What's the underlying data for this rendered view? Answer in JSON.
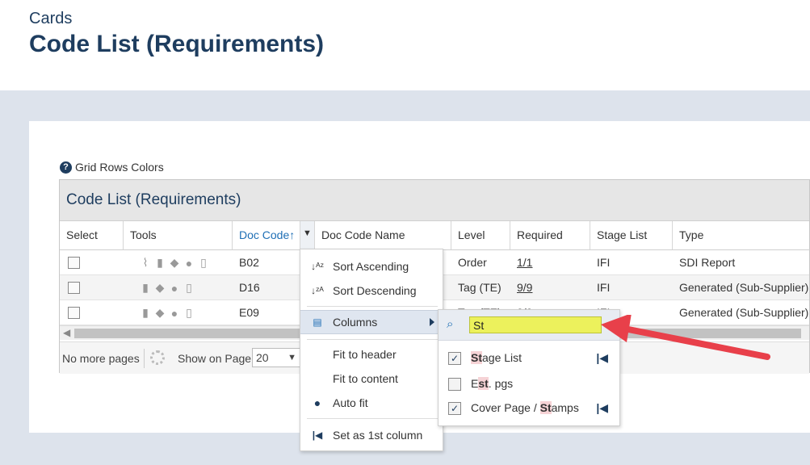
{
  "header": {
    "breadcrumb": "Cards",
    "title": "Code List (Requirements)"
  },
  "grid_colors_label": "Grid Rows Colors",
  "grid": {
    "caption": "Code List (Requirements)",
    "columns": {
      "select": "Select",
      "tools": "Tools",
      "doc_code": "Doc Code",
      "doc_code_name": "Doc Code Name",
      "level": "Level",
      "required": "Required",
      "stage_list": "Stage List",
      "type": "Type"
    },
    "sort_indicator": "↑",
    "rows": [
      {
        "doc_code": "B02",
        "level": "Order",
        "required": "1/1",
        "stage_list": "IFI",
        "type": "SDI Report"
      },
      {
        "doc_code": "D16",
        "level": "Tag (TE)",
        "required": "9/9",
        "stage_list": "IFI",
        "type": "Generated (Sub-Supplier)"
      },
      {
        "doc_code": "E09",
        "level": "Tag (TE)",
        "required": "9/9",
        "stage_list": "IFI",
        "type": "Generated (Sub-Supplier)"
      }
    ]
  },
  "pager": {
    "no_more_pages": "No more pages",
    "show_on_page_label": "Show on Page:",
    "page_size": "20"
  },
  "column_menu": {
    "sort_ascending": "Sort Ascending",
    "sort_descending": "Sort Descending",
    "columns": "Columns",
    "fit_to_header": "Fit to header",
    "fit_to_content": "Fit to content",
    "auto_fit": "Auto fit",
    "set_first_column": "Set as 1st column"
  },
  "columns_submenu": {
    "search_value": "St",
    "items": [
      {
        "label": "Stage List",
        "checked": true,
        "pinned": true
      },
      {
        "label": "Est. pgs",
        "checked": false,
        "pinned": false
      },
      {
        "label": "Cover Page / Stamps",
        "checked": true,
        "pinned": true
      }
    ]
  },
  "colors": {
    "title": "#1e3d5f",
    "link": "#1f6fb5",
    "search_highlight": "#ecf15c",
    "arrow": "#e8404a",
    "band": "#dde3ec"
  }
}
